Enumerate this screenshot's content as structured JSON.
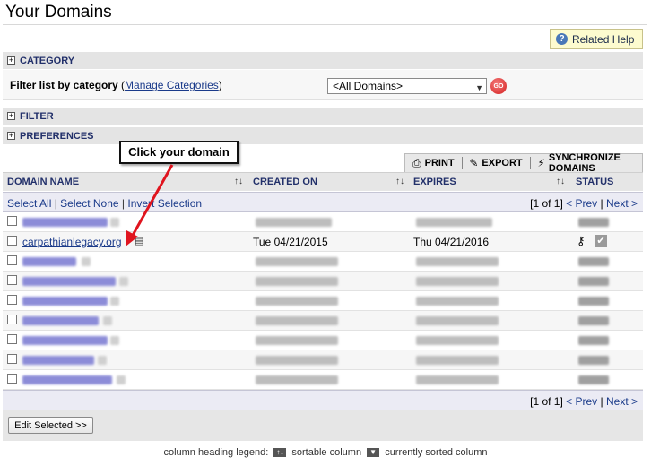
{
  "page": {
    "title": "Your Domains"
  },
  "help": {
    "label": "Related Help",
    "icon": "question-icon"
  },
  "sections": {
    "category": "CATEGORY",
    "filter": "FILTER",
    "preferences": "PREFERENCES"
  },
  "filter_panel": {
    "label": "Filter list by category",
    "open_paren": "(",
    "manage_link": "Manage Categories",
    "close_paren": ")",
    "selected_option": "<All Domains>",
    "go_label": "GO"
  },
  "toolbar": {
    "print": "PRINT",
    "export": "EXPORT",
    "sync": "SYNCHRONIZE DOMAINS"
  },
  "columns": {
    "domain_name": "DOMAIN NAME",
    "created_on": "CREATED ON",
    "expires": "EXPIRES",
    "status": "STATUS"
  },
  "selection": {
    "select_all": "Select All",
    "select_none": "Select None",
    "invert": "Invert Selection",
    "sep": "|"
  },
  "pager": {
    "position": "[1 of 1]",
    "prev": "< Prev",
    "sep": "|",
    "next": "Next >"
  },
  "domain_row": {
    "domain": "carpathianlegacy.org",
    "created": "Tue 04/21/2015",
    "expires": "Thu 04/21/2016"
  },
  "callout": {
    "text": "Click your domain"
  },
  "edit": {
    "label": "Edit Selected >>"
  },
  "legend": {
    "prefix": "column heading legend:",
    "sortable": "sortable column",
    "sorted": "currently sorted column"
  },
  "colors": {
    "header_text": "#22306a",
    "link": "#1a3a8a",
    "arrow": "#e0141e",
    "help_bg": "#fdfbcf"
  }
}
